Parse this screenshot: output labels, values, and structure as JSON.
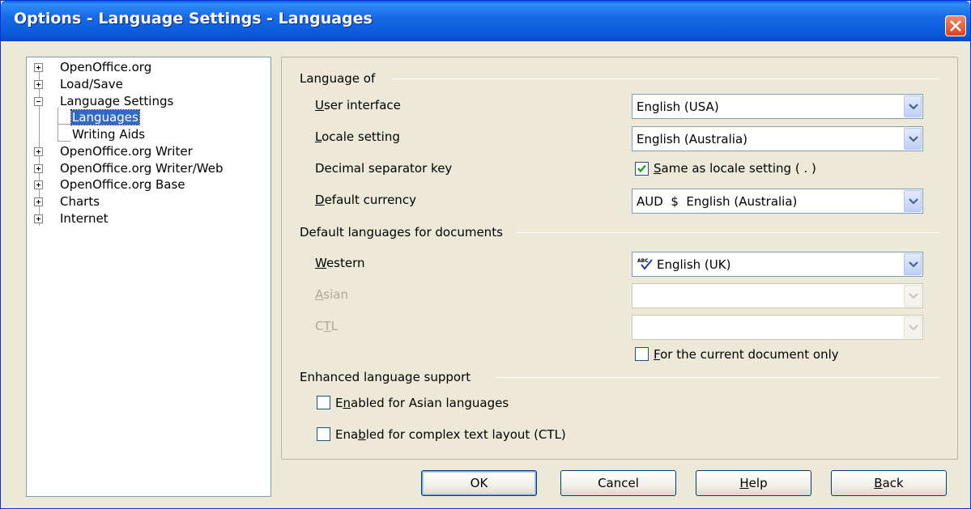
{
  "window": {
    "title": "Options - Language Settings - Languages"
  },
  "tree": {
    "items": [
      {
        "label": "OpenOffice.org",
        "expander": "plus"
      },
      {
        "label": "Load/Save",
        "expander": "plus"
      },
      {
        "label": "Language Settings",
        "expander": "minus"
      },
      {
        "label": "Languages",
        "selected": true
      },
      {
        "label": "Writing Aids"
      },
      {
        "label": "OpenOffice.org Writer",
        "expander": "plus"
      },
      {
        "label": "OpenOffice.org Writer/Web",
        "expander": "plus"
      },
      {
        "label": "OpenOffice.org Base",
        "expander": "plus"
      },
      {
        "label": "Charts",
        "expander": "plus"
      },
      {
        "label": "Internet",
        "expander": "plus"
      }
    ]
  },
  "language_of": {
    "group_label": "Language of",
    "user_interface": {
      "label_pre": "",
      "label_mn": "U",
      "label_post": "ser interface",
      "value": "English (USA)"
    },
    "locale": {
      "label_pre": "",
      "label_mn": "L",
      "label_post": "ocale setting",
      "value": "English (Australia)"
    },
    "decimal": {
      "label": "Decimal separator key",
      "check_mn": "S",
      "check_post": "ame as locale setting ( . )",
      "checked": true
    },
    "currency": {
      "label_pre": "",
      "label_mn": "D",
      "label_post": "efault currency",
      "value": "AUD  $  English (Australia)"
    }
  },
  "default_languages": {
    "group_label": "Default languages for documents",
    "western": {
      "label_pre": "",
      "label_mn": "W",
      "label_post": "estern",
      "value": "English (UK)",
      "icon": "spellcheck-abc-icon"
    },
    "asian": {
      "label_pre": "",
      "label_mn": "A",
      "label_post": "sian",
      "value": ""
    },
    "ctl": {
      "label_pre": "C",
      "label_mn": "T",
      "label_post": "L",
      "value": ""
    },
    "current_doc": {
      "check_mn": "F",
      "check_post": "or the current document only",
      "checked": false
    }
  },
  "enhanced": {
    "group_label": "Enhanced language support",
    "asian": {
      "pre": "E",
      "mn": "n",
      "post": "abled for Asian languages",
      "checked": false
    },
    "ctl": {
      "pre": "Ena",
      "mn": "b",
      "post": "led for complex text layout (CTL)",
      "checked": false
    }
  },
  "buttons": {
    "ok": "OK",
    "cancel": "Cancel",
    "help_mn": "H",
    "help_post": "elp",
    "back_mn": "B",
    "back_post": "ack"
  },
  "colors": {
    "titlebar": "#0a58d8",
    "selection": "#316ac5",
    "dialog_bg": "#ece9d8"
  }
}
